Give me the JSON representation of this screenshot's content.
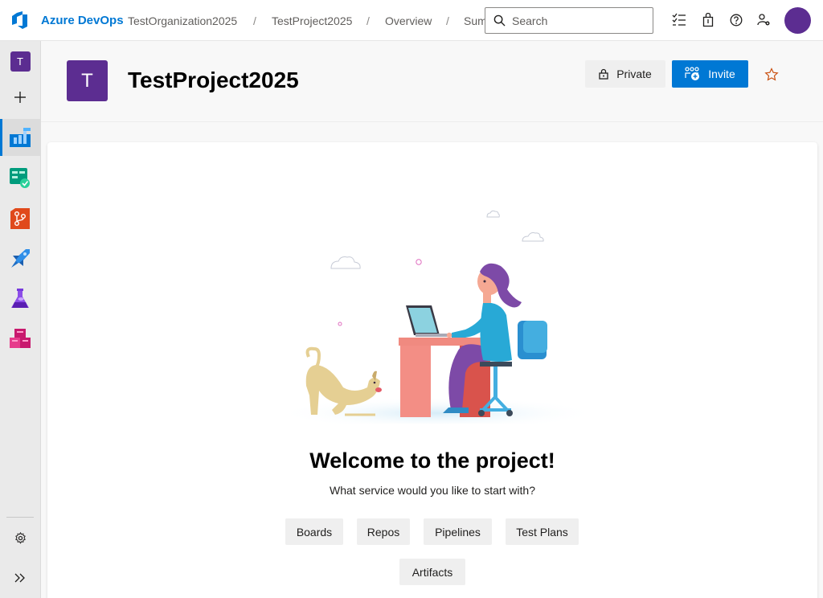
{
  "topbar": {
    "brand": "Azure DevOps",
    "breadcrumbs": [
      "TestOrganization2025",
      "TestProject2025",
      "Overview",
      "Summary"
    ],
    "separator": "/",
    "search_placeholder": "Search",
    "icons": [
      "work-items-icon",
      "marketplace-bag-icon",
      "help-icon",
      "user-settings-icon"
    ],
    "avatar_color": "#5c2d91"
  },
  "rail": {
    "project_initial": "T",
    "items": [
      "add-icon",
      "overview-icon",
      "boards-icon",
      "repos-icon",
      "pipelines-icon",
      "test-plans-icon",
      "artifacts-icon"
    ],
    "footer": [
      "settings-icon",
      "expand-icon"
    ]
  },
  "header": {
    "project_initial": "T",
    "project_name": "TestProject2025",
    "private_label": "Private",
    "invite_label": "Invite"
  },
  "welcome": {
    "title": "Welcome to the project!",
    "subtitle": "What service would you like to start with?",
    "services": [
      "Boards",
      "Repos",
      "Pipelines",
      "Test Plans",
      "Artifacts"
    ]
  },
  "colors": {
    "accent": "#0078d4",
    "project": "#5c2d91"
  }
}
